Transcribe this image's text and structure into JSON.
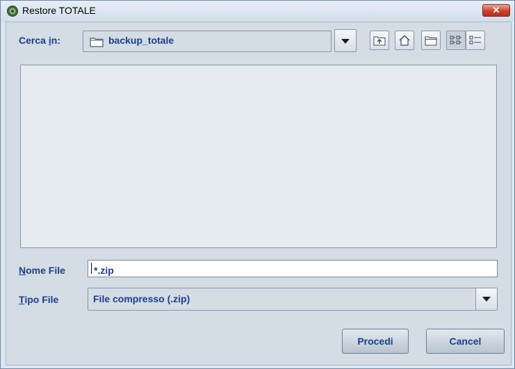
{
  "window": {
    "title": "Restore TOTALE",
    "close_icon": "close-icon"
  },
  "lookin": {
    "label_pre": "Cerca ",
    "label_mnemonic": "i",
    "label_post": "n:",
    "value": "backup_totale"
  },
  "toolbar": {
    "buttons": [
      "up-one-level-icon",
      "home-icon",
      "new-folder-icon",
      "list-view-icon",
      "details-view-icon"
    ]
  },
  "filename": {
    "label_mnemonic": "N",
    "label_rest": "ome File",
    "value": "*.zip"
  },
  "filetype": {
    "label_mnemonic": "T",
    "label_rest": "ipo File",
    "value": "File compresso (.zip)"
  },
  "actions": {
    "primary": "Procedi",
    "cancel": "Cancel"
  },
  "colors": {
    "accent_text": "#1a3e8a",
    "window_bg": "#d4dce4",
    "close_red": "#c9402a"
  }
}
